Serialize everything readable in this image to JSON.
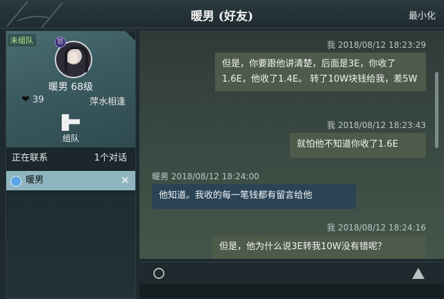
{
  "window": {
    "title": "暖男 (好友)",
    "minimize_label": "最小化"
  },
  "profile": {
    "team_status": "未组队",
    "badge": "怒",
    "name_level": "暖男  68级",
    "hearts": "39",
    "motto": "萍水相逢",
    "team_button_label": "组队"
  },
  "contacts": {
    "header_left": "正在联系",
    "header_right": "1个对话",
    "items": [
      {
        "name": "暖男"
      }
    ]
  },
  "messages": [
    {
      "from": "me",
      "meta": "我  2018/08/12  18:23:29",
      "text": "但是，你要跟他讲清楚，后面是3E，你收了1.6E，他收了1.4E。 转了10W块钱给我，差5W"
    },
    {
      "from": "me",
      "meta": "我  2018/08/12  18:23:43",
      "text": "就怕他不知道你收了1.6E"
    },
    {
      "from": "them",
      "meta": "暖男  2018/08/12  18:24:00",
      "text": "他知道。我收的每一笔钱都有留言给他"
    },
    {
      "from": "me",
      "meta": "我  2018/08/12  18:24:16",
      "text": "但是，他为什么说3E转我10W没有错呢？"
    }
  ],
  "colors": {
    "contact_highlight": "#8fb6be",
    "my_bubble": "#4e5a4a",
    "their_bubble": "#2a4456"
  },
  "icons": [
    "emoji-icon",
    "warning-icon",
    "close-icon",
    "team-icon"
  ]
}
